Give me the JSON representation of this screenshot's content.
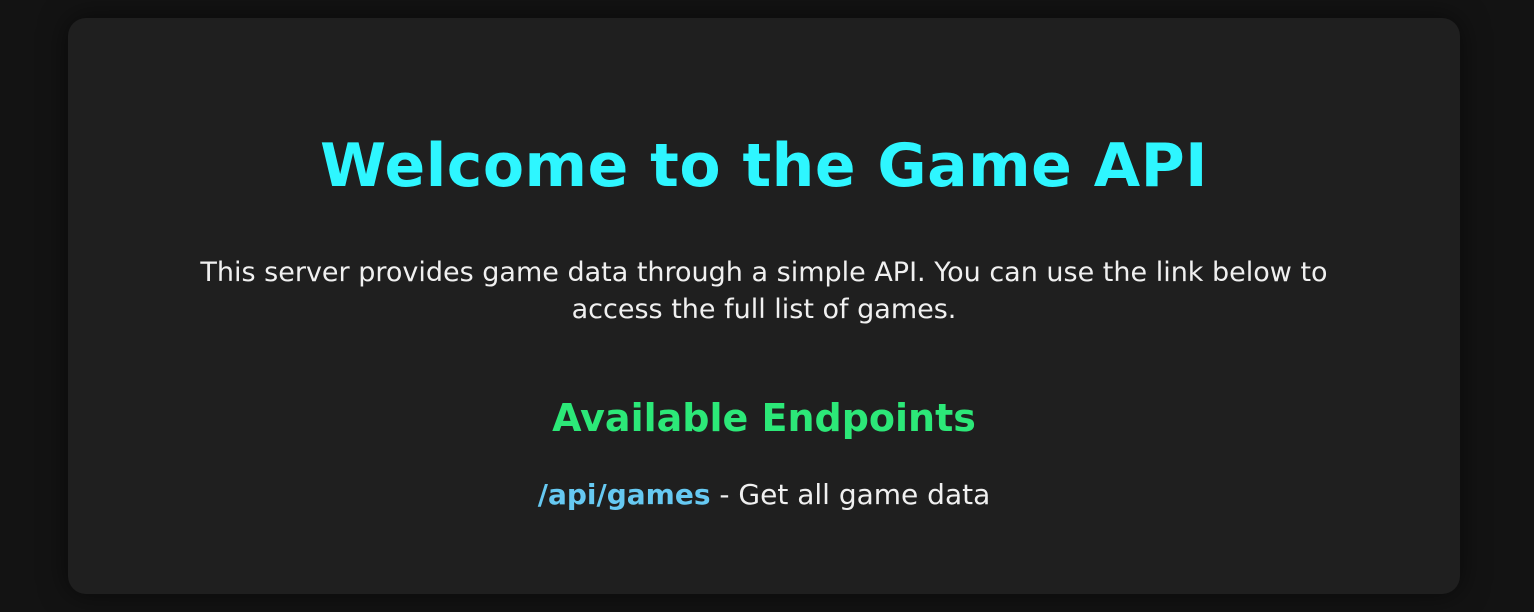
{
  "page": {
    "title": "Welcome to the Game API",
    "description_line1": "This server provides game data through a simple API. You can use the link below to",
    "description_line2": "access the full list of games."
  },
  "endpoints": {
    "heading": "Available Endpoints",
    "items": [
      {
        "path": "/api/games",
        "separator": " - ",
        "description": "Get all game data"
      }
    ]
  },
  "colors": {
    "background": "#131313",
    "card": "#1f1f1f",
    "title": "#2ef6ff",
    "heading": "#2ce878",
    "link": "#66c9f2",
    "text": "#f0f0f0"
  }
}
